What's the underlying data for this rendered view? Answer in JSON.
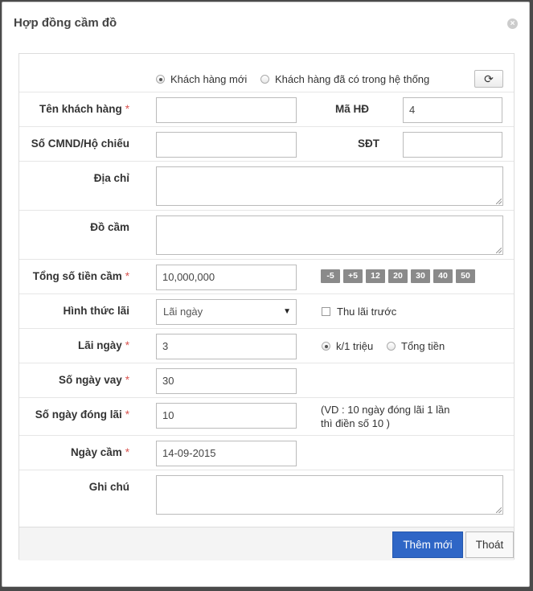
{
  "modal": {
    "title": "Hợp đồng cầm đồ",
    "close_glyph": "×"
  },
  "customer_type": {
    "new_label": "Khách hàng mới",
    "existing_label": "Khách hàng đã có trong hệ thống",
    "selected": "new",
    "refresh_glyph": "⟳"
  },
  "fields": {
    "customer_name": {
      "label": "Tên khách hàng",
      "required": "*",
      "value": ""
    },
    "contract_code": {
      "label": "Mã HĐ",
      "value": "4"
    },
    "id_number": {
      "label": "Số CMND/Hộ chiếu",
      "value": ""
    },
    "phone": {
      "label": "SĐT",
      "value": ""
    },
    "address": {
      "label": "Địa chỉ",
      "value": ""
    },
    "item": {
      "label": "Đồ cầm",
      "value": ""
    },
    "amount": {
      "label": "Tổng số tiền cầm",
      "required": "*",
      "value": "10,000,000"
    },
    "interest_type": {
      "label": "Hình thức lãi",
      "value": "Lãi ngày",
      "caret": "▼"
    },
    "prepay": {
      "label": "Thu lãi trước",
      "checked": false
    },
    "daily_interest": {
      "label": "Lãi ngày",
      "required": "*",
      "value": "3"
    },
    "interest_unit": {
      "per_million_label": "k/1 triệu",
      "total_label": "Tổng tiền",
      "selected": "per_million"
    },
    "loan_days": {
      "label": "Số ngày vay",
      "required": "*",
      "value": "30"
    },
    "payment_days": {
      "label": "Số ngày đóng lãi",
      "required": "*",
      "value": "10",
      "note_line1": "(VD : 10 ngày đóng lãi 1 lần",
      "note_line2": "thì điền số 10 )"
    },
    "pawn_date": {
      "label": "Ngày cầm",
      "required": "*",
      "value": "14-09-2015"
    },
    "notes": {
      "label": "Ghi chú",
      "value": ""
    }
  },
  "quick_amounts": [
    "-5",
    "+5",
    "12",
    "20",
    "30",
    "40",
    "50"
  ],
  "footer": {
    "submit_label": "Thêm mới",
    "exit_label": "Thoát"
  },
  "colors": {
    "primary": "#2f66c6",
    "required": "#d9534f",
    "quick_button": "#8a8a8a"
  }
}
